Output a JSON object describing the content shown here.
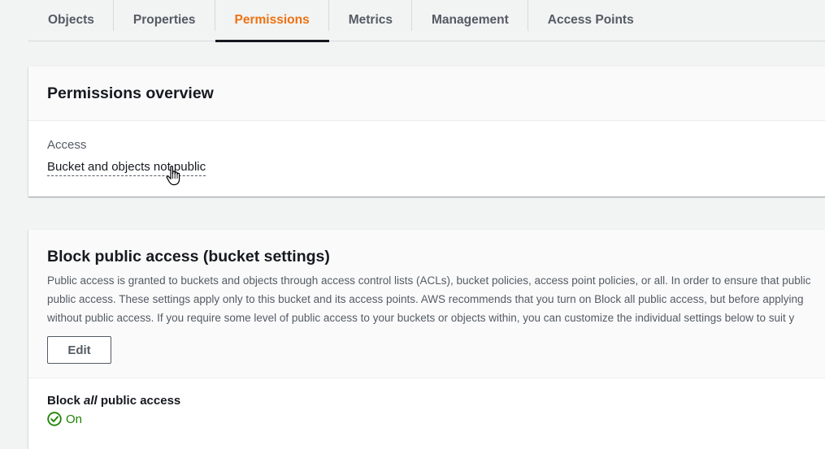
{
  "tabs": [
    {
      "label": "Objects"
    },
    {
      "label": "Properties"
    },
    {
      "label": "Permissions",
      "active": true
    },
    {
      "label": "Metrics"
    },
    {
      "label": "Management"
    },
    {
      "label": "Access Points"
    }
  ],
  "overview": {
    "title": "Permissions overview",
    "access_label": "Access",
    "access_value": "Bucket and objects not public"
  },
  "block_public_access": {
    "title": "Block public access (bucket settings)",
    "description_lines": [
      "Public access is granted to buckets and objects through access control lists (ACLs), bucket policies, access point policies, or all. In order to ensure that public",
      "public access. These settings apply only to this bucket and its access points. AWS recommends that you turn on Block all public access, but before applying",
      "without public access. If you require some level of public access to your buckets or objects within, you can customize the individual settings below to suit y"
    ],
    "edit_label": "Edit",
    "setting_prefix": "Block ",
    "setting_emphasis": "all",
    "setting_suffix": " public access",
    "status": "On"
  },
  "colors": {
    "active_tab": "#ec7211",
    "status_on": "#1d8102"
  },
  "icons": [
    "pointer-hand-cursor-icon",
    "check-circle-icon"
  ]
}
